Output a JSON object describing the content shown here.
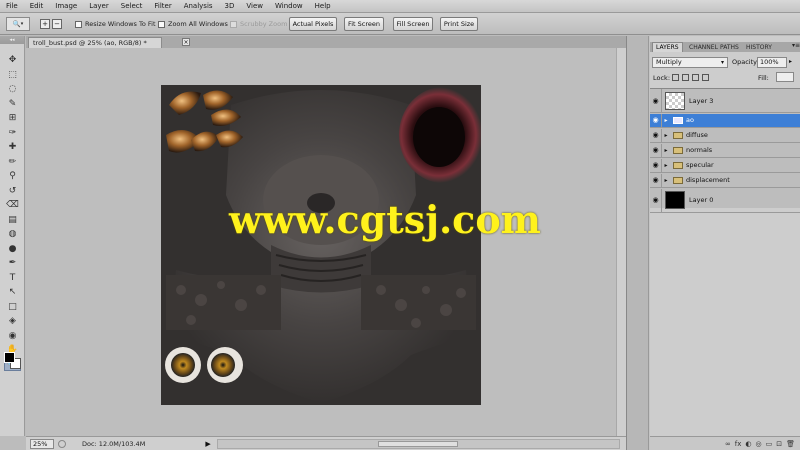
{
  "menu": [
    "File",
    "Edit",
    "Image",
    "Layer",
    "Select",
    "Filter",
    "Analysis",
    "3D",
    "View",
    "Window",
    "Help"
  ],
  "options": {
    "resize_windows": "Resize Windows To Fit",
    "zoom_all": "Zoom All Windows",
    "scrubby_zoom": "Scrubby Zoom",
    "actual_pixels": "Actual Pixels",
    "fit_screen": "Fit Screen",
    "fill_screen": "Fill Screen",
    "print_size": "Print Size"
  },
  "document": {
    "tab_title": "troll_bust.psd @ 25% (ao, RGB/8) *",
    "close_glyph": "×",
    "watermark": "www.cgtsj.com"
  },
  "status": {
    "zoom": "25%",
    "doc_size": "Doc: 12.0M/103.4M",
    "arrow": "▶"
  },
  "panel": {
    "tabs": [
      "LAYERS",
      "CHANNEL",
      "PATHS",
      "HISTORY"
    ],
    "menu_glyph": "▾≡",
    "blend_mode": "Multiply",
    "opacity_label": "Opacity:",
    "opacity_value": "100%",
    "lock_label": "Lock:",
    "fill_label": "Fill:",
    "footer_icons": [
      "∞",
      "fx",
      "◐",
      "◎",
      "▭",
      "⊡",
      "🗑"
    ]
  },
  "layers": [
    {
      "name": "Layer 3",
      "kind": "pixel",
      "thumb": "checker",
      "selected": false,
      "visible": true
    },
    {
      "name": "ao",
      "kind": "group",
      "selected": true,
      "visible": true
    },
    {
      "name": "diffuse",
      "kind": "group",
      "selected": false,
      "visible": true
    },
    {
      "name": "normals",
      "kind": "group",
      "selected": false,
      "visible": true
    },
    {
      "name": "specular",
      "kind": "group",
      "selected": false,
      "visible": true
    },
    {
      "name": "displacement",
      "kind": "group",
      "selected": false,
      "visible": true
    },
    {
      "name": "Layer 0",
      "kind": "pixel",
      "thumb": "black",
      "selected": false,
      "visible": true
    }
  ],
  "tools": [
    "move-tool",
    "marquee-tool",
    "lasso-tool",
    "quick-select-tool",
    "crop-tool",
    "eyedropper-tool",
    "healing-brush-tool",
    "brush-tool",
    "clone-stamp-tool",
    "history-brush-tool",
    "eraser-tool",
    "gradient-tool",
    "blur-tool",
    "dodge-tool",
    "pen-tool",
    "type-tool",
    "path-select-tool",
    "shape-tool",
    "3d-rotate-tool",
    "3d-orbit-tool",
    "hand-tool",
    "zoom-tool"
  ],
  "colors": {
    "foreground": "#000000",
    "background": "#ffffff",
    "selection": "#3d7fd6",
    "watermark": "#fff21c"
  }
}
